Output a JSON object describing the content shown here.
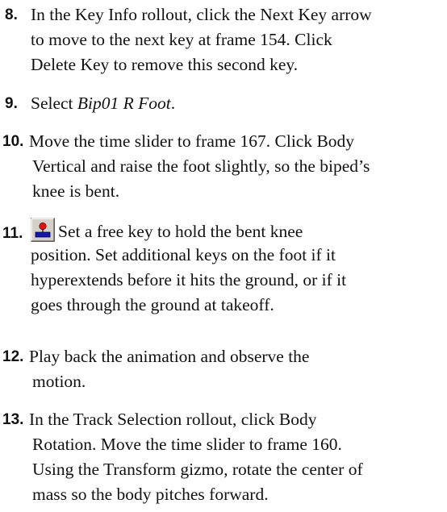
{
  "steps": [
    {
      "number": "8.",
      "lines": [
        "In the Key Info rollout, click the Next Key arrow",
        "to move to the next key at frame 154. Click",
        "Delete Key to remove this second key."
      ]
    },
    {
      "number": "9.",
      "prefix": "Select ",
      "italic": "Bip01 R Foot",
      "suffix": "."
    },
    {
      "number": "10.",
      "lines": [
        "Move the time slider to frame 167. Click Body",
        "Vertical and raise the foot slightly, so the biped’s",
        "knee is bent."
      ]
    },
    {
      "number": "11.",
      "icon": "set-free-key-icon",
      "lines": [
        "Set a free key to hold the bent knee",
        "position. Set additional keys on the foot if it",
        "hyperextends before it hits the ground, or if it",
        "goes through the ground at takeoff."
      ]
    },
    {
      "number": "12.",
      "lines": [
        "Play back the animation and observe the",
        "motion."
      ]
    },
    {
      "number": "13.",
      "lines": [
        "In the Track Selection rollout, click Body",
        "Rotation. Move the time slider to frame 160.",
        "Using the Transform gizmo, rotate the center of",
        "mass so the body pitches forward."
      ]
    }
  ]
}
